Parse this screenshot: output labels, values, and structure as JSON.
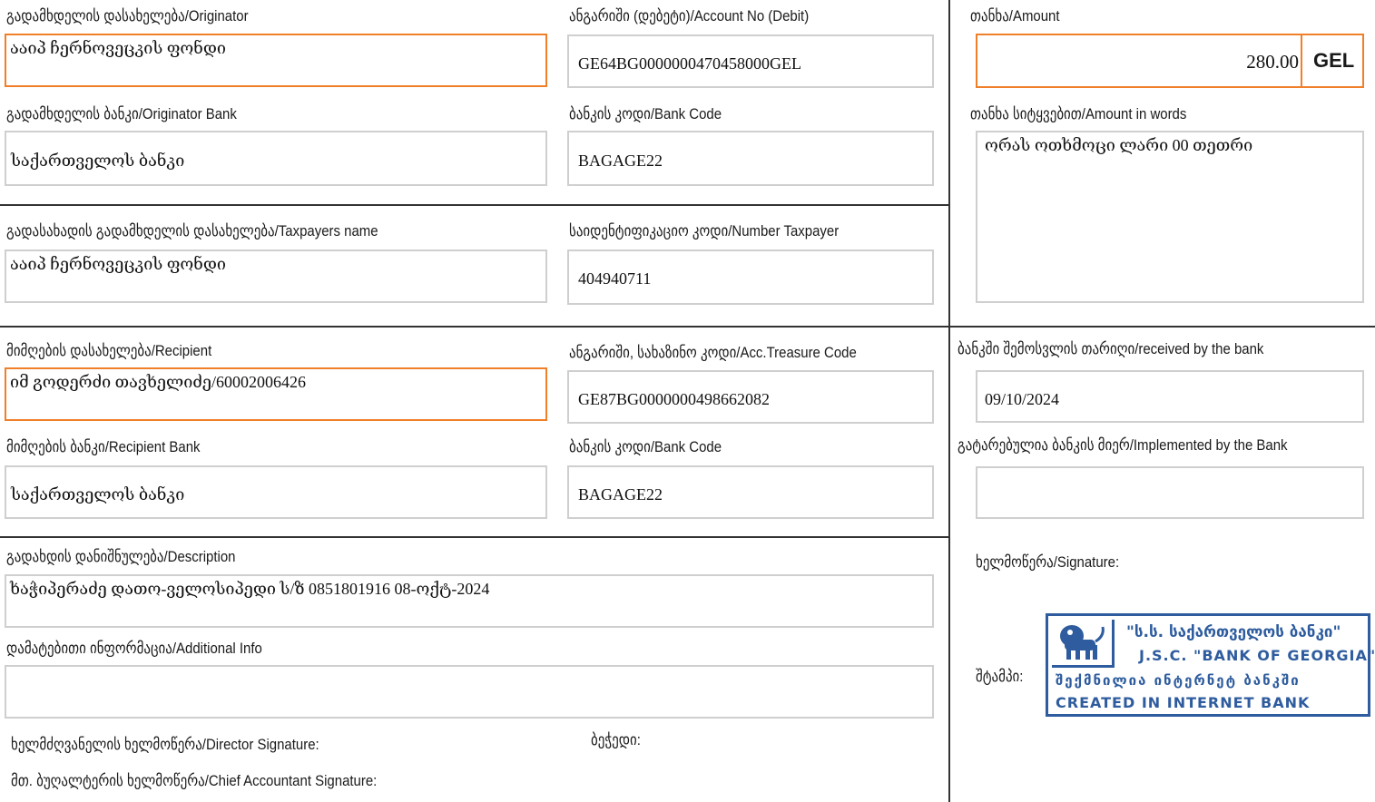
{
  "originator": {
    "label": "გადამხდელის დასახელება/Originator",
    "value": "ააიპ ჩერნოვეცკის ფონდი"
  },
  "account_debit": {
    "label": "ანგარიში (დებეტი)/Account No (Debit)",
    "value": "GE64BG0000000470458000GEL"
  },
  "amount": {
    "label": "თანხა/Amount",
    "value": "280.00",
    "currency": "GEL"
  },
  "originator_bank": {
    "label": "გადამხდელის ბანკი/Originator Bank",
    "value": "საქართველოს ბანკი"
  },
  "originator_bank_code": {
    "label": "ბანკის კოდი/Bank Code",
    "value": "BAGAGE22"
  },
  "amount_words": {
    "label": "თანხა სიტყვებით/Amount in words",
    "value": "ორას ოთხმოცი ლარი 00 თეთრი"
  },
  "taxpayer_name": {
    "label": "გადასახადის გადამხდელის დასახელება/Taxpayers name",
    "value": "ააიპ ჩერნოვეცკის ფონდი"
  },
  "taxpayer_number": {
    "label": "საიდენტიფიკაციო კოდი/Number Taxpayer",
    "value": "404940711"
  },
  "recipient": {
    "label": "მიმღების დასახელება/Recipient",
    "value": "იმ გოდერძი თავხელიძე/60002006426"
  },
  "treasury_code": {
    "label": "ანგარიში, სახაზინო კოდი/Acc.Treasure Code",
    "value": "GE87BG0000000498662082"
  },
  "received_by_bank": {
    "label": "ბანკში შემოსვლის თარიღი/received by the bank",
    "value": "09/10/2024"
  },
  "recipient_bank": {
    "label": "მიმღების ბანკი/Recipient Bank",
    "value": "საქართველოს ბანკი"
  },
  "recipient_bank_code": {
    "label": "ბანკის კოდი/Bank Code",
    "value": "BAGAGE22"
  },
  "implemented_by_bank": {
    "label": "გატარებულია ბანკის მიერ/Implemented by the Bank",
    "value": ""
  },
  "description": {
    "label": "გადახდის დანიშნულება/Description",
    "value": "ხაჭიპერაძე დათო-ველოსიპედი ს/ზ 0851801916 08-ოქტ-2024"
  },
  "additional_info": {
    "label": "დამატებითი ინფორმაცია/Additional Info",
    "value": ""
  },
  "signatures": {
    "director": "ხელმძღვანელის ხელმოწერა/Director Signature:",
    "seal": "ბეჭედი:",
    "chief_accountant": "მთ. ბუღალტერის ხელმოწერა/Chief Accountant Signature:",
    "signature": "ხელმოწერა/Signature:",
    "stamp_label": "შტამპი:"
  },
  "stamp": {
    "line1": "\"ს.ს. საქართველოს ბანკი\"",
    "line2": "J.S.C. \"BANK OF GEORGIA\"",
    "line3": "შექმნილია ინტერნეტ ბანკში",
    "line4": "CREATED IN INTERNET BANK",
    "color": "#2e5c9e"
  },
  "colors": {
    "highlight_border": "#f07f2a",
    "field_border": "#cfcfcf",
    "divider": "#333333"
  }
}
